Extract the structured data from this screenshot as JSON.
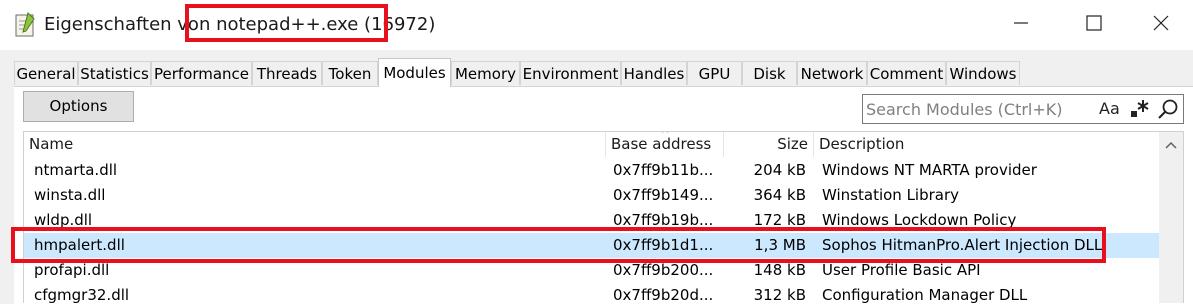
{
  "window": {
    "title_prefix": "Eigenschaften von ",
    "title_process": "notepad++.exe (16972)",
    "highlight_color": "#e8101c"
  },
  "tabs": [
    {
      "label": "General"
    },
    {
      "label": "Statistics"
    },
    {
      "label": "Performance"
    },
    {
      "label": "Threads"
    },
    {
      "label": "Token"
    },
    {
      "label": "Modules",
      "active": true
    },
    {
      "label": "Memory"
    },
    {
      "label": "Environment"
    },
    {
      "label": "Handles"
    },
    {
      "label": "GPU"
    },
    {
      "label": "Disk"
    },
    {
      "label": "Network"
    },
    {
      "label": "Comment"
    },
    {
      "label": "Windows"
    }
  ],
  "toolbar": {
    "options_label": "Options",
    "search_placeholder": "Search Modules (Ctrl+K)",
    "case_toggle": "Aa",
    "icons": [
      "regex-icon",
      "search-icon"
    ]
  },
  "table": {
    "columns": [
      "Name",
      "Base address",
      "Size",
      "Description"
    ],
    "rows": [
      {
        "name": "ntmarta.dll",
        "base": "0x7ff9b11b...",
        "size": "204 kB",
        "description": "Windows NT MARTA provider"
      },
      {
        "name": "winsta.dll",
        "base": "0x7ff9b149...",
        "size": "364 kB",
        "description": "Winstation Library"
      },
      {
        "name": "wldp.dll",
        "base": "0x7ff9b19b...",
        "size": "172 kB",
        "description": "Windows Lockdown Policy"
      },
      {
        "name": "hmpalert.dll",
        "base": "0x7ff9b1d1...",
        "size": "1,3 MB",
        "description": "Sophos HitmanPro.Alert Injection DLL",
        "selected": true
      },
      {
        "name": "profapi.dll",
        "base": "0x7ff9b200...",
        "size": "148 kB",
        "description": "User Profile Basic API"
      },
      {
        "name": "cfgmgr32.dll",
        "base": "0x7ff9b20d...",
        "size": "312 kB",
        "description": "Configuration Manager DLL"
      }
    ],
    "selected_row_color": "#cce8ff"
  }
}
